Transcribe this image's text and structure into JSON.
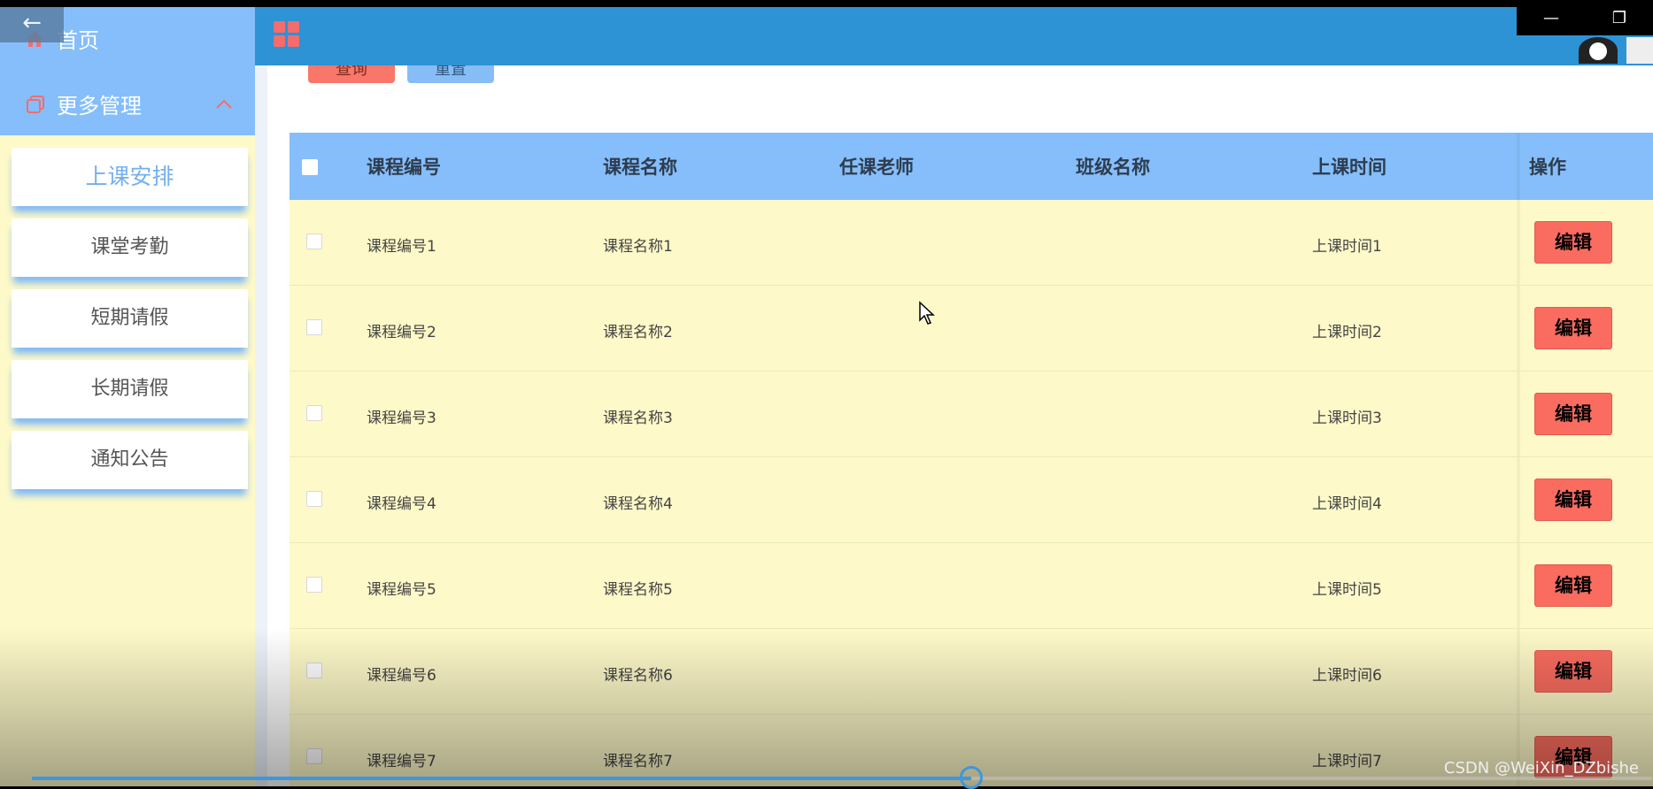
{
  "sidebar": {
    "back_icon": "arrow-left-icon",
    "home_label": "首页",
    "more_label": "更多管理",
    "items": [
      {
        "label": "上课安排",
        "active": true
      },
      {
        "label": "课堂考勤",
        "active": false
      },
      {
        "label": "短期请假",
        "active": false
      },
      {
        "label": "长期请假",
        "active": false
      },
      {
        "label": "通知公告",
        "active": false
      }
    ]
  },
  "header": {
    "menu_icon": "grid-icon",
    "window_controls": [
      "minimize-icon",
      "restore-icon"
    ]
  },
  "toolbar": {
    "search_label": "查询",
    "reset_label": "重置"
  },
  "table": {
    "columns": [
      "课程编号",
      "课程名称",
      "任课老师",
      "班级名称",
      "上课时间",
      "操作"
    ],
    "rows": [
      {
        "code": "课程编号1",
        "name": "课程名称1",
        "teacher": "",
        "class": "",
        "time": "上课时间1",
        "action": "编辑"
      },
      {
        "code": "课程编号2",
        "name": "课程名称2",
        "teacher": "",
        "class": "",
        "time": "上课时间2",
        "action": "编辑"
      },
      {
        "code": "课程编号3",
        "name": "课程名称3",
        "teacher": "",
        "class": "",
        "time": "上课时间3",
        "action": "编辑"
      },
      {
        "code": "课程编号4",
        "name": "课程名称4",
        "teacher": "",
        "class": "",
        "time": "上课时间4",
        "action": "编辑"
      },
      {
        "code": "课程编号5",
        "name": "课程名称5",
        "teacher": "",
        "class": "",
        "time": "上课时间5",
        "action": "编辑"
      },
      {
        "code": "课程编号6",
        "name": "课程名称6",
        "teacher": "",
        "class": "",
        "time": "上课时间6",
        "action": "编辑"
      },
      {
        "code": "课程编号7",
        "name": "课程名称7",
        "teacher": "",
        "class": "",
        "time": "上课时间7",
        "action": "编辑"
      }
    ]
  },
  "video": {
    "progress": 0.58,
    "watermark": "CSDN @WeiXin_DZbishe"
  },
  "colors": {
    "header": "#2D93D5",
    "sidebar_top": "#85BEFA",
    "body_bg": "#FEF9C8",
    "edit_button": "#FA6C5F",
    "accent_text": "#74B0ED"
  }
}
